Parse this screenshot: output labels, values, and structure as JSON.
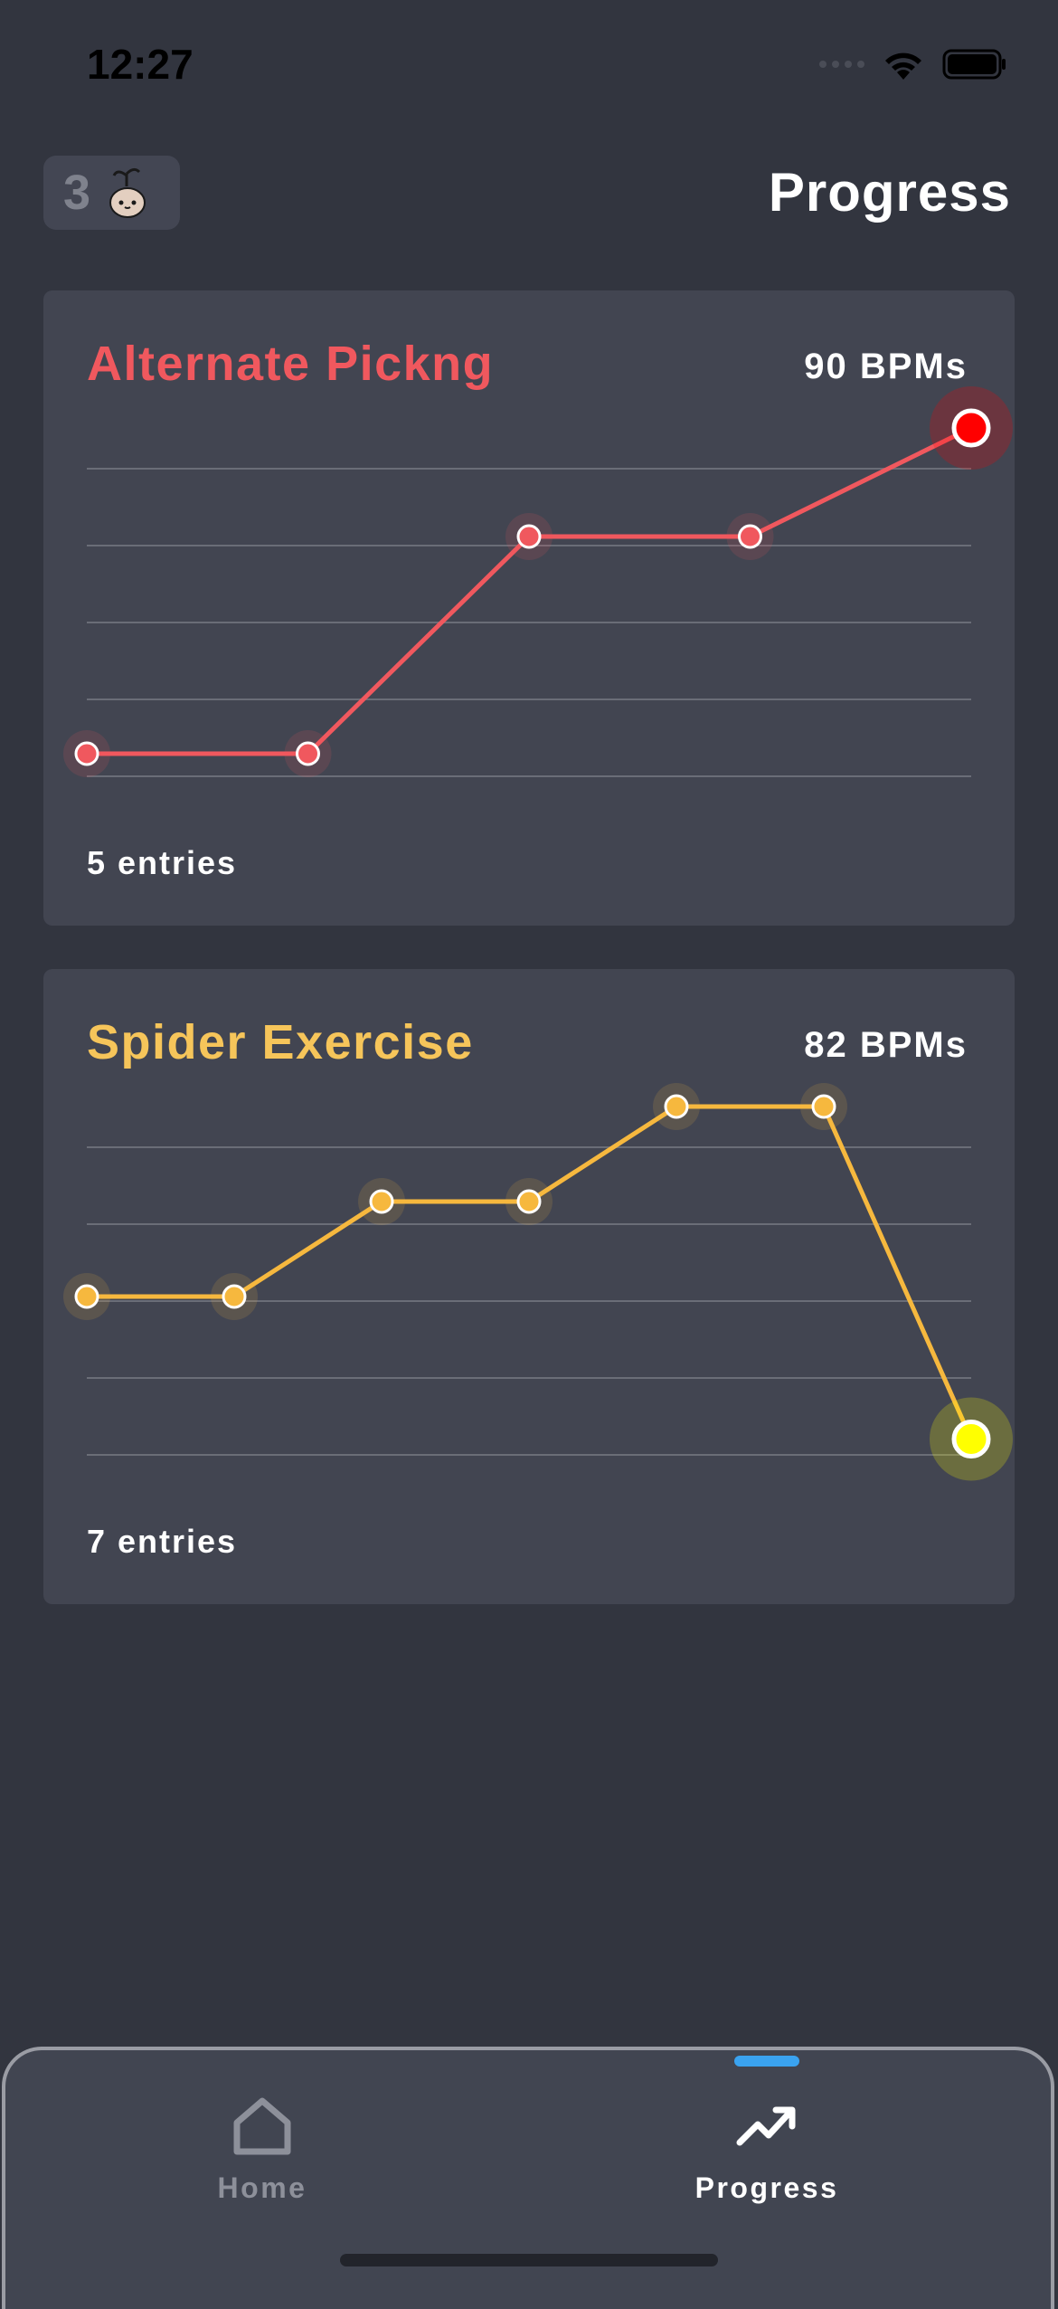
{
  "status_bar": {
    "time": "12:27"
  },
  "header": {
    "streak_count": "3",
    "title": "Progress",
    "mascot_icon": "sprout-mascot-icon"
  },
  "exercises": [
    {
      "name": "Alternate Pickng",
      "current_bpm": "90 BPMs",
      "entries_label": "5 entries",
      "color": "#f0585e",
      "highlight_color": "#ff0000"
    },
    {
      "name": "Spider Exercise",
      "current_bpm": "82 BPMs",
      "entries_label": "7 entries",
      "color": "#f6b83e",
      "highlight_color": "#ffff00"
    }
  ],
  "chart_data": [
    {
      "type": "line",
      "series": [
        {
          "values": [
            1,
            1,
            5,
            5,
            7
          ]
        }
      ],
      "grid": true,
      "ylim": [
        0,
        7
      ]
    },
    {
      "type": "line",
      "series": [
        {
          "values": [
            4,
            4,
            6,
            6,
            8,
            8,
            1
          ]
        }
      ],
      "grid": true,
      "ylim": [
        0,
        8
      ]
    }
  ],
  "tab_bar": {
    "tabs": [
      {
        "label": "Home",
        "icon": "home-icon",
        "active": false
      },
      {
        "label": "Progress",
        "icon": "trending-up-icon",
        "active": true
      }
    ]
  }
}
